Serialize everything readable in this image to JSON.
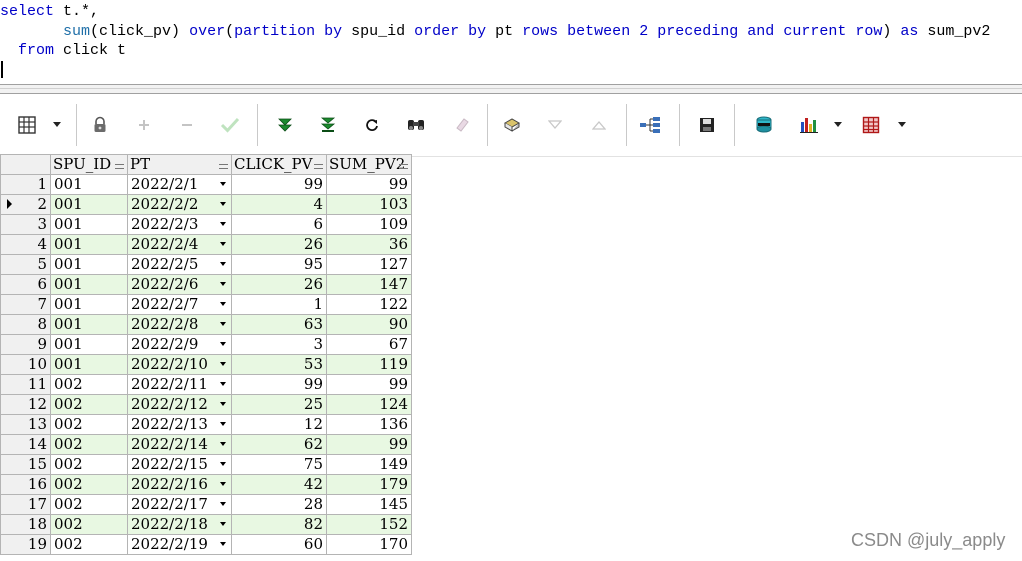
{
  "editor": {
    "lines": [
      [
        {
          "t": "select",
          "c": "kw"
        },
        {
          "t": " t.*,",
          "c": "pl"
        }
      ],
      [
        {
          "t": "       ",
          "c": "pl"
        },
        {
          "t": "sum",
          "c": "fn"
        },
        {
          "t": "(click_pv) ",
          "c": "pl"
        },
        {
          "t": "over",
          "c": "kw"
        },
        {
          "t": "(",
          "c": "pl"
        },
        {
          "t": "partition by",
          "c": "kw"
        },
        {
          "t": " spu_id ",
          "c": "pl"
        },
        {
          "t": "order by",
          "c": "kw"
        },
        {
          "t": " pt ",
          "c": "pl"
        },
        {
          "t": "rows between",
          "c": "kw"
        },
        {
          "t": " ",
          "c": "pl"
        },
        {
          "t": "2",
          "c": "nm"
        },
        {
          "t": " ",
          "c": "pl"
        },
        {
          "t": "preceding",
          "c": "kw"
        },
        {
          "t": " ",
          "c": "pl"
        },
        {
          "t": "and",
          "c": "kw"
        },
        {
          "t": " ",
          "c": "pl"
        },
        {
          "t": "current row",
          "c": "kw"
        },
        {
          "t": ") ",
          "c": "pl"
        },
        {
          "t": "as",
          "c": "kw"
        },
        {
          "t": " sum_pv2",
          "c": "pl"
        }
      ],
      [
        {
          "t": "  ",
          "c": "pl"
        },
        {
          "t": "from",
          "c": "kw"
        },
        {
          "t": " click t",
          "c": "pl"
        }
      ]
    ]
  },
  "toolbar": {
    "buttons": [
      {
        "name": "grid-view-button",
        "icon": "grid-icon"
      },
      {
        "name": "lock-button",
        "icon": "lock-icon"
      },
      {
        "name": "insert-record-button",
        "icon": "plus-icon"
      },
      {
        "name": "delete-record-button",
        "icon": "minus-icon"
      },
      {
        "name": "post-changes-button",
        "icon": "check-icon"
      },
      {
        "name": "fetch-next-page-button",
        "icon": "double-chevron-down-icon"
      },
      {
        "name": "fetch-last-page-button",
        "icon": "chevron-down-bar-icon"
      },
      {
        "name": "refresh-button",
        "icon": "refresh-icon"
      },
      {
        "name": "find-button",
        "icon": "binoculars-icon"
      },
      {
        "name": "clear-button",
        "icon": "eraser-icon"
      },
      {
        "name": "query-by-example-button",
        "icon": "query-icon"
      },
      {
        "name": "next-record-button",
        "icon": "triangle-down-icon"
      },
      {
        "name": "previous-record-button",
        "icon": "triangle-up-icon"
      },
      {
        "name": "tree-view-button",
        "icon": "tree-icon"
      },
      {
        "name": "save-button",
        "icon": "floppy-icon"
      },
      {
        "name": "export-button",
        "icon": "database-export-icon"
      },
      {
        "name": "chart-button",
        "icon": "bar-chart-icon"
      },
      {
        "name": "table-options-button",
        "icon": "table-icon"
      }
    ]
  },
  "grid": {
    "columns": [
      "SPU_ID",
      "PT",
      "CLICK_PV",
      "SUM_PV2"
    ],
    "current_row": 2,
    "rows": [
      {
        "n": "1",
        "spu": "001",
        "pt": "2022/2/1",
        "pv": "99",
        "sum": "99"
      },
      {
        "n": "2",
        "spu": "001",
        "pt": "2022/2/2",
        "pv": "4",
        "sum": "103"
      },
      {
        "n": "3",
        "spu": "001",
        "pt": "2022/2/3",
        "pv": "6",
        "sum": "109"
      },
      {
        "n": "4",
        "spu": "001",
        "pt": "2022/2/4",
        "pv": "26",
        "sum": "36"
      },
      {
        "n": "5",
        "spu": "001",
        "pt": "2022/2/5",
        "pv": "95",
        "sum": "127"
      },
      {
        "n": "6",
        "spu": "001",
        "pt": "2022/2/6",
        "pv": "26",
        "sum": "147"
      },
      {
        "n": "7",
        "spu": "001",
        "pt": "2022/2/7",
        "pv": "1",
        "sum": "122"
      },
      {
        "n": "8",
        "spu": "001",
        "pt": "2022/2/8",
        "pv": "63",
        "sum": "90"
      },
      {
        "n": "9",
        "spu": "001",
        "pt": "2022/2/9",
        "pv": "3",
        "sum": "67"
      },
      {
        "n": "10",
        "spu": "001",
        "pt": "2022/2/10",
        "pv": "53",
        "sum": "119"
      },
      {
        "n": "11",
        "spu": "002",
        "pt": "2022/2/11",
        "pv": "99",
        "sum": "99"
      },
      {
        "n": "12",
        "spu": "002",
        "pt": "2022/2/12",
        "pv": "25",
        "sum": "124"
      },
      {
        "n": "13",
        "spu": "002",
        "pt": "2022/2/13",
        "pv": "12",
        "sum": "136"
      },
      {
        "n": "14",
        "spu": "002",
        "pt": "2022/2/14",
        "pv": "62",
        "sum": "99"
      },
      {
        "n": "15",
        "spu": "002",
        "pt": "2022/2/15",
        "pv": "75",
        "sum": "149"
      },
      {
        "n": "16",
        "spu": "002",
        "pt": "2022/2/16",
        "pv": "42",
        "sum": "179"
      },
      {
        "n": "17",
        "spu": "002",
        "pt": "2022/2/17",
        "pv": "28",
        "sum": "145"
      },
      {
        "n": "18",
        "spu": "002",
        "pt": "2022/2/18",
        "pv": "82",
        "sum": "152"
      },
      {
        "n": "19",
        "spu": "002",
        "pt": "2022/2/19",
        "pv": "60",
        "sum": "170"
      }
    ]
  },
  "watermark": "CSDN @july_apply",
  "colors": {
    "keyword": "#0000c8",
    "function": "#1f6fa8",
    "row_alt": "#e8f8e2",
    "header": "#f0f0f0"
  }
}
